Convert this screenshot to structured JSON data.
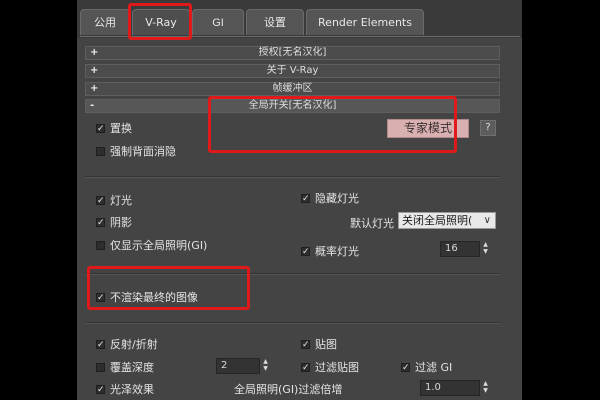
{
  "tabs": [
    {
      "label": "公用"
    },
    {
      "label": "V-Ray"
    },
    {
      "label": "GI"
    },
    {
      "label": "设置"
    },
    {
      "label": "Render Elements"
    }
  ],
  "rollouts": [
    {
      "sign": "+",
      "label": "授权[无名汉化]"
    },
    {
      "sign": "+",
      "label": "关于 V-Ray"
    },
    {
      "sign": "+",
      "label": "帧缓冲区"
    },
    {
      "sign": "-",
      "label": "全局开关[无名汉化]"
    }
  ],
  "global_switches": {
    "displacement": {
      "label": "置换",
      "checked": true
    },
    "force_back_culling": {
      "label": "强制背面消隐",
      "checked": false
    },
    "expert_mode_button": "专家模式",
    "help_button": "?",
    "lights": {
      "label": "灯光",
      "checked": true
    },
    "hidden_lights": {
      "label": "隐藏灯光",
      "checked": true
    },
    "shadows": {
      "label": "阴影",
      "checked": true
    },
    "default_lights_label": "默认灯光",
    "default_lights_value": "关闭全局照明(",
    "show_gi_only": {
      "label": "仅显示全局照明(GI)",
      "checked": false
    },
    "probabilistic_lights": {
      "label": "概率灯光",
      "checked": true,
      "value": "16"
    },
    "dont_render_final_image": {
      "label": "不渲染最终的图像",
      "checked": true
    },
    "reflection_refraction": {
      "label": "反射/折射",
      "checked": true
    },
    "maps": {
      "label": "贴图",
      "checked": true
    },
    "override_depth": {
      "label": "覆盖深度",
      "checked": false,
      "value": "2"
    },
    "filter_maps": {
      "label": "过滤贴图",
      "checked": true
    },
    "filter_gi": {
      "label": "过滤 GI",
      "checked": true
    },
    "glossy_effects": {
      "label": "光泽效果",
      "checked": true
    },
    "gi_filter_multiplier_label": "全局照明(GI)过滤倍增",
    "gi_filter_multiplier_value": "1.0"
  },
  "colors": {
    "highlight": "#e01a1a",
    "panel_bg": "#444444",
    "expert_button_bg": "#d8b0b0"
  }
}
